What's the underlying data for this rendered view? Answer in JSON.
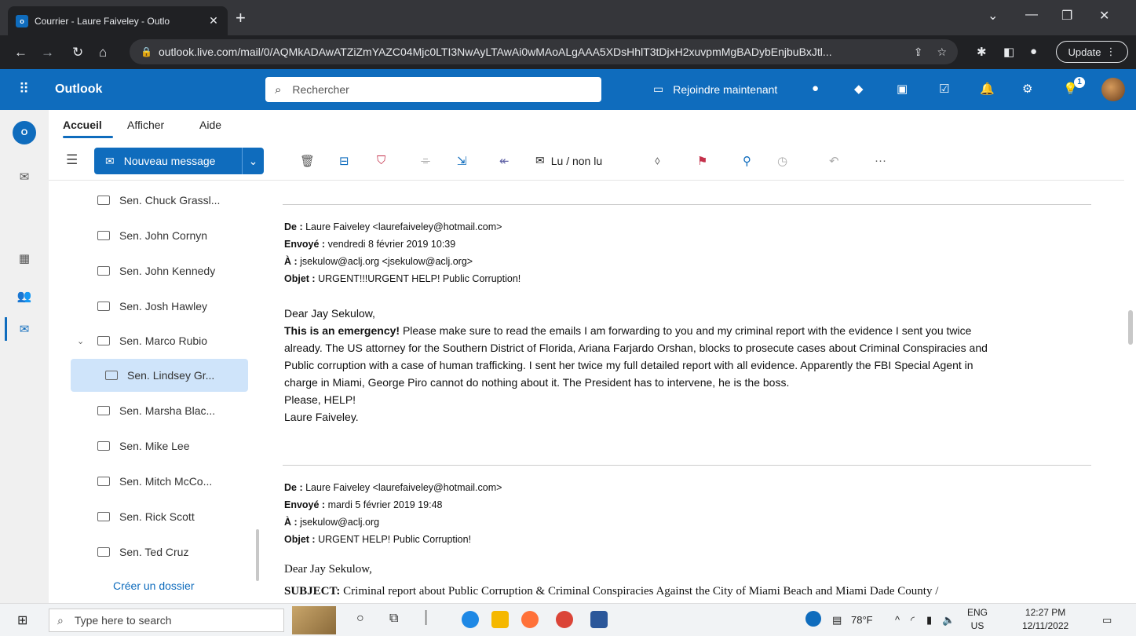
{
  "browser": {
    "tab_title": "Courrier - Laure Faiveley - Outlo",
    "tab_close": "✕",
    "new_tab": "+",
    "url": "outlook.live.com/mail/0/AQMkADAwATZiZmYAZC04Mjc0LTI3NwAyLTAwAi0wMAoALgAAA5XDsHhlT3tDjxH2xuvpmMgBADybEnjbuBxJtl...",
    "update_label": "Update"
  },
  "outlook": {
    "brand": "Outlook",
    "search_placeholder": "Rechercher",
    "join_label": "Rejoindre maintenant",
    "notification_count": "1"
  },
  "ribbon": {
    "tabs": [
      "Accueil",
      "Afficher",
      "Aide"
    ],
    "new_message": "Nouveau message",
    "read_unread": "Lu / non lu",
    "more": "···"
  },
  "folders": {
    "items": [
      {
        "label": "Sen. Chuck Grassl..."
      },
      {
        "label": "Sen. John Cornyn"
      },
      {
        "label": "Sen. John Kennedy"
      },
      {
        "label": "Sen. Josh Hawley"
      },
      {
        "label": "Sen. Marco Rubio"
      },
      {
        "label": "Sen. Lindsey Gr..."
      },
      {
        "label": "Sen. Marsha Blac..."
      },
      {
        "label": "Sen. Mike Lee"
      },
      {
        "label": "Sen. Mitch McCo..."
      },
      {
        "label": "Sen. Rick Scott"
      },
      {
        "label": "Sen. Ted Cruz"
      }
    ],
    "create_folder": "Créer un dossier"
  },
  "message1": {
    "from_label": "De :",
    "from_value": "Laure Faiveley <laurefaiveley@hotmail.com>",
    "sent_label": "Envoyé :",
    "sent_value": "vendredi 8 février 2019 10:39",
    "to_label": "À :",
    "to_value": "jsekulow@aclj.org <jsekulow@aclj.org>",
    "subject_label": "Objet :",
    "subject_value": "URGENT!!!URGENT HELP! Public Corruption!",
    "greeting": "Dear Jay Sekulow,",
    "emphasis": "This is an emergency!",
    "line1": " Please make sure to read the emails I am forwarding to you and my criminal report with the evidence I sent you twice",
    "line2": "already. The US attorney for the Southern District of Florida, Ariana Farjardo Orshan, blocks to prosecute cases about Criminal Conspiracies and",
    "line3": "Public corruption with a case of human trafficking. I sent her twice my full detailed report with all evidence. Apparently the FBI Special Agent in",
    "line4": "charge in Miami, George Piro cannot do nothing about it. The President has to intervene, he is the boss.",
    "line5": "Please, HELP!",
    "signature": "Laure Faiveley."
  },
  "message2": {
    "from_label": "De :",
    "from_value": "Laure Faiveley <laurefaiveley@hotmail.com>",
    "sent_label": "Envoyé :",
    "sent_value": "mardi 5 février 2019 19:48",
    "to_label": "À :",
    "to_value": "jsekulow@aclj.org",
    "subject_label": "Objet :",
    "subject_value": "URGENT HELP! Public Corruption!",
    "greeting": "Dear Jay Sekulow,",
    "subject_heading": "SUBJECT:",
    "subject_text": " Criminal report about Public Corruption & Criminal Conspiracies Against the City of Miami Beach and Miami Dade County /"
  },
  "taskbar": {
    "search_placeholder": "Type here to search",
    "weather": "78°F",
    "lang": "ENG",
    "region": "US",
    "time": "12:27 PM",
    "date": "12/11/2022"
  },
  "colors": {
    "brand_blue": "#0f6cbd",
    "selected_folder": "#cfe4fa",
    "flag_red": "#c4314b"
  }
}
